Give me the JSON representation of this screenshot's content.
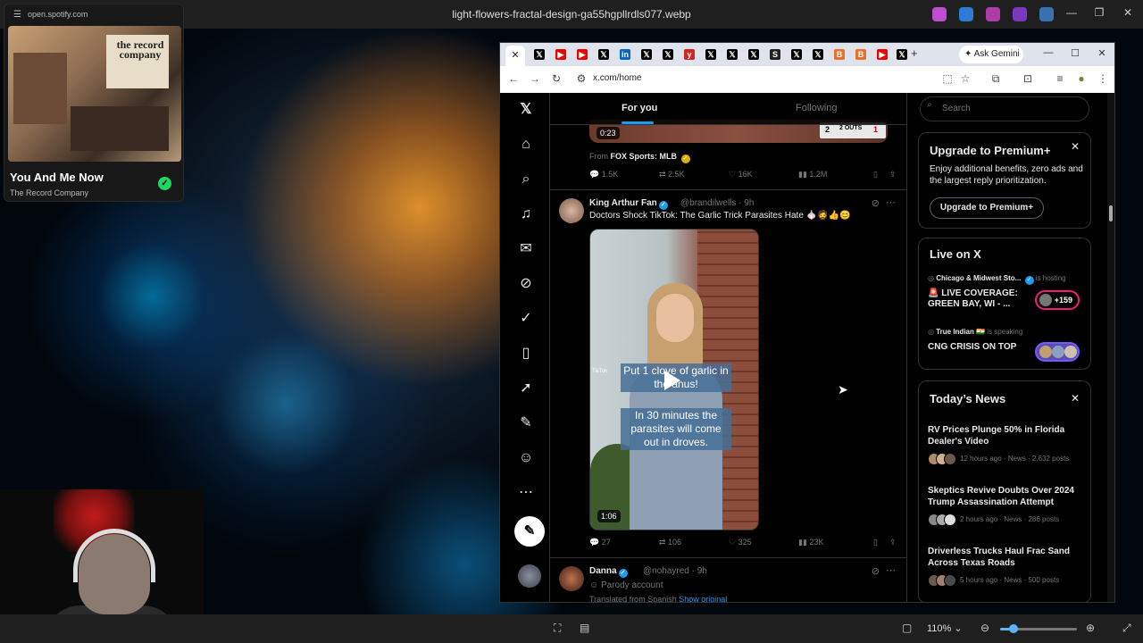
{
  "viewer": {
    "title": "light-flowers-fractal-design-ga55hgpllrdls077.webp",
    "zoom": "110%"
  },
  "spotify": {
    "url": "open.spotify.com",
    "album_text": "the record company",
    "track": "You And Me Now",
    "artist": "The Record Company",
    "accent": "#1ed760"
  },
  "browser": {
    "url": "x.com/home",
    "gemini_label": "Ask Gemini",
    "tab_icons": [
      "close-icon",
      "x-icon",
      "youtube-icon",
      "x-icon",
      "x-icon",
      "linkedin-icon",
      "x-icon",
      "x-icon",
      "yelp-icon",
      "x-icon",
      "x-icon",
      "x-icon",
      "s-icon",
      "x-icon",
      "x-icon",
      "b-icon",
      "b-icon",
      "youtube-icon",
      "x-icon",
      "link-icon"
    ]
  },
  "x": {
    "tabs": {
      "for_you": "For you",
      "following": "Following"
    },
    "accent": "#1d9bf0",
    "first_post": {
      "duration": "0:23",
      "score_left": "2",
      "score_outs": "2 OUTS",
      "score_right": "1",
      "from_prefix": "From",
      "from_source": "FOX Sports: MLB",
      "replies": "1.5K",
      "reposts": "2.5K",
      "likes": "16K",
      "views": "1.2M"
    },
    "second_post": {
      "name": "King Arthur Fan",
      "handle": "@brandilwells · 9h",
      "text": "Doctors Shock TikTok: The Garlic Trick Parasites Hate 🧄🧔👍😊",
      "caption1": "Put 1 clove of garlic in the anus!",
      "caption2": "In 30 minutes the parasites will come out in droves.",
      "tiktok": "TikTok",
      "duration": "1:06",
      "replies": "27",
      "reposts": "106",
      "likes": "325",
      "views": "23K"
    },
    "third_post": {
      "name": "Danna",
      "handle": "@nohayred · 9h",
      "label": "Parody account",
      "translated": "Translated from Spanish",
      "show_original": "Show original"
    },
    "search": {
      "placeholder": "Search"
    },
    "premium": {
      "title": "Upgrade to Premium+",
      "desc": "Enjoy additional benefits, zero ads and the largest reply prioritization.",
      "button": "Upgrade to Premium+"
    },
    "live": {
      "title": "Live on X",
      "items": [
        {
          "host": "Chicago & Midwest Sto...",
          "status": "is hosting",
          "title": "🚨 LIVE COVERAGE: GREEN BAY, WI - ...",
          "count": "+159"
        },
        {
          "host": "True Indian 🇮🇳",
          "status": "is speaking",
          "title": "CNG CRISIS ON TOP"
        }
      ]
    },
    "news": {
      "title": "Today’s News",
      "items": [
        {
          "title": "RV Prices Plunge 50% in Florida Dealer's Video",
          "meta": "12 hours ago · News · 2,632 posts"
        },
        {
          "title": "Skeptics Revive Doubts Over 2024 Trump Assassination Attempt",
          "meta": "2 hours ago · News · 286 posts"
        },
        {
          "title": "Driverless Trucks Haul Frac Sand Across Texas Roads",
          "meta": "5 hours ago · News · 500 posts"
        }
      ]
    }
  }
}
